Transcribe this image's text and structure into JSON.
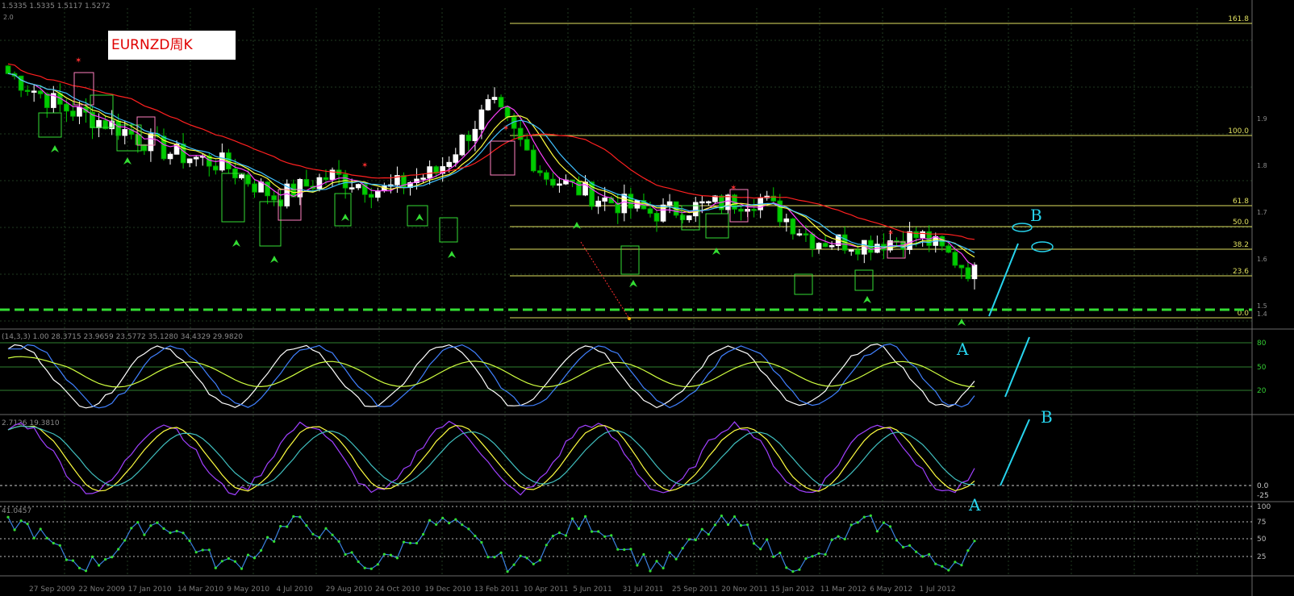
{
  "chart_title": "EURNZD周K",
  "header_text": "1.5335 1.5335 1.5117 1.5272",
  "price_labels": {
    "right": [
      "1.9",
      "1.8",
      "1.7",
      "1.6",
      "1.5",
      "1.4"
    ],
    "top": "2.0"
  },
  "fib_labels": [
    "161.8",
    "100.0",
    "61.8",
    "50.0",
    "38.2",
    "23.6",
    "0.0"
  ],
  "annotations": {
    "A": "A",
    "B": "B"
  },
  "panels": {
    "stoch": {
      "header": "(14,3,3) 1.00 28.3715 23.9659 23.5772 35.1280 34.4329 29.9820",
      "levels": [
        "80",
        "50",
        "20"
      ]
    },
    "macd": {
      "header": "2.7126 19.3810",
      "levels": [
        "0.0",
        "-25"
      ]
    },
    "rsi": {
      "header": "41.0457",
      "levels": [
        "100",
        "75",
        "50",
        "25"
      ]
    }
  },
  "date_labels": [
    "27 Sep 2009",
    "22 Nov 2009",
    "17 Jan 2010",
    "14 Mar 2010",
    "9 May 2010",
    "4 Jul 2010",
    "29 Aug 2010",
    "24 Oct 2010",
    "19 Dec 2010",
    "13 Feb 2011",
    "10 Apr 2011",
    "5 Jun 2011",
    "31 Jul 2011",
    "25 Sep 2011",
    "20 Nov 2011",
    "15 Jan 2012",
    "11 Mar 2012",
    "6 May 2012",
    "1 Jul 2012"
  ],
  "colors": {
    "bull": "#ffffff",
    "bear": "#00cc00",
    "ma_fast": "#ff40ff",
    "ma_mid": "#ffff40",
    "ma_slow": "#ff2020",
    "fib": "#e0e060",
    "dash": "#33dd33",
    "annot": "#27d4ee",
    "grid": "#1f3a1f"
  },
  "chart_data": [
    {
      "type": "candlestick",
      "title": "EURNZD周K",
      "ylabel": "",
      "x": [
        "27 Sep 2009",
        "22 Nov 2009",
        "17 Jan 2010",
        "14 Mar 2010",
        "9 May 2010",
        "4 Jul 2010",
        "29 Aug 2010",
        "24 Oct 2010",
        "19 Dec 2010",
        "13 Feb 2011",
        "10 Apr 2011",
        "5 Jun 2011",
        "31 Jul 2011",
        "25 Sep 2011",
        "20 Nov 2011",
        "15 Jan 2012",
        "11 Mar 2012",
        "6 May 2012",
        "1 Jul 2012"
      ],
      "close_keypoints": [
        2.07,
        1.98,
        1.93,
        1.86,
        1.83,
        1.74,
        1.8,
        1.76,
        1.81,
        1.99,
        1.8,
        1.74,
        1.7,
        1.72,
        1.74,
        1.63,
        1.62,
        1.64,
        1.54
      ],
      "ylim": [
        1.4,
        2.2
      ],
      "fib_levels": [
        {
          "label": "161.8",
          "price": 2.2
        },
        {
          "label": "100.0",
          "price": 1.95
        },
        {
          "label": "61.8",
          "price": 1.8
        },
        {
          "label": "50.0",
          "price": 1.75
        },
        {
          "label": "38.2",
          "price": 1.7
        },
        {
          "label": "23.6",
          "price": 1.64
        },
        {
          "label": "0.0",
          "price": 1.54
        }
      ]
    },
    {
      "type": "line",
      "title": "",
      "levels": [
        80,
        50,
        20
      ],
      "ylim": [
        0,
        100
      ]
    },
    {
      "type": "line",
      "title": "",
      "levels": [
        0,
        -25
      ]
    },
    {
      "type": "line",
      "title": "",
      "levels": [
        100,
        75,
        50,
        25
      ],
      "ylim": [
        0,
        100
      ]
    }
  ]
}
